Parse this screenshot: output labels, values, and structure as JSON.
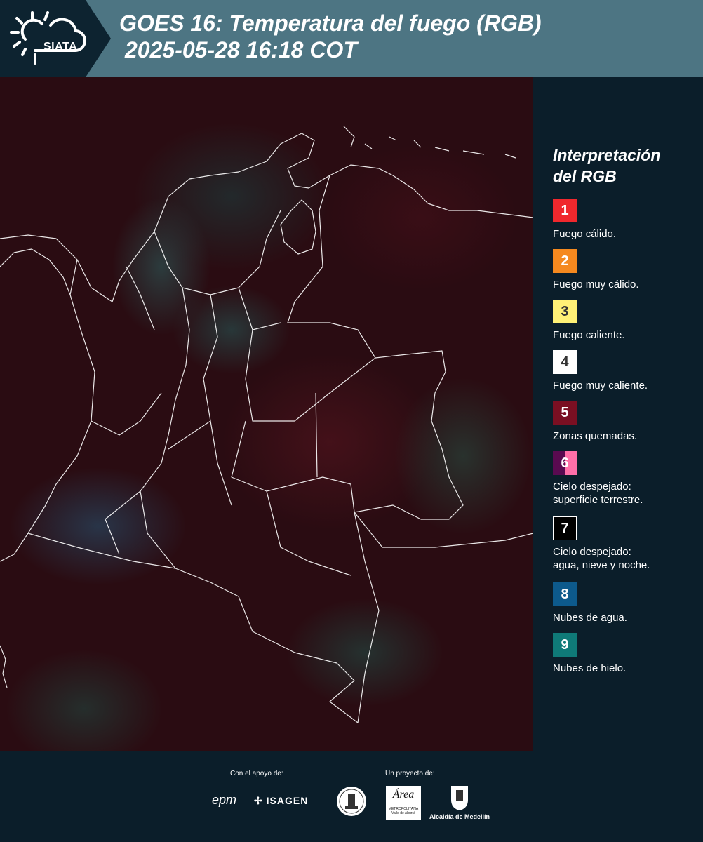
{
  "header": {
    "logo_text": "SIATA",
    "title_line1": "GOES 16: Temperatura del fuego (RGB)",
    "title_line2": "2025-05-28 16:18 COT"
  },
  "legend": {
    "title_line1": "Interpretación",
    "title_line2": "del RGB",
    "items": [
      {
        "num": "1",
        "color": "#f0282d",
        "label_line1": "Fuego cálido.",
        "label_line2": ""
      },
      {
        "num": "2",
        "color": "#f5891f",
        "label_line1": "Fuego muy cálido.",
        "label_line2": ""
      },
      {
        "num": "3",
        "color": "#fff176",
        "label_line1": "Fuego caliente.",
        "label_line2": ""
      },
      {
        "num": "4",
        "color": "#ffffff",
        "label_line1": "Fuego muy caliente.",
        "label_line2": ""
      },
      {
        "num": "5",
        "color": "#7a0f22",
        "label_line1": "Zonas quemadas.",
        "label_line2": ""
      },
      {
        "num": "6",
        "color": "#5a0a50",
        "label_line1": "Cielo despejado:",
        "label_line2": "superficie terrestre."
      },
      {
        "num": "7",
        "color": "#000000",
        "label_line1": "Cielo despejado:",
        "label_line2": "agua, nieve y noche."
      },
      {
        "num": "8",
        "color": "#0d5a8c",
        "label_line1": "Nubes de agua.",
        "label_line2": ""
      },
      {
        "num": "9",
        "color": "#0f7a78",
        "label_line1": "Nubes de hielo.",
        "label_line2": ""
      }
    ]
  },
  "footer": {
    "support_label": "Con el apoyo de:",
    "project_label": "Un proyecto de:",
    "epm": "epm",
    "isagen": "ISAGEN",
    "area_logo": "Área",
    "area_sub": "METROPOLITANA Valle de Aburrá",
    "medellin": "Alcaldía de Medellín"
  }
}
